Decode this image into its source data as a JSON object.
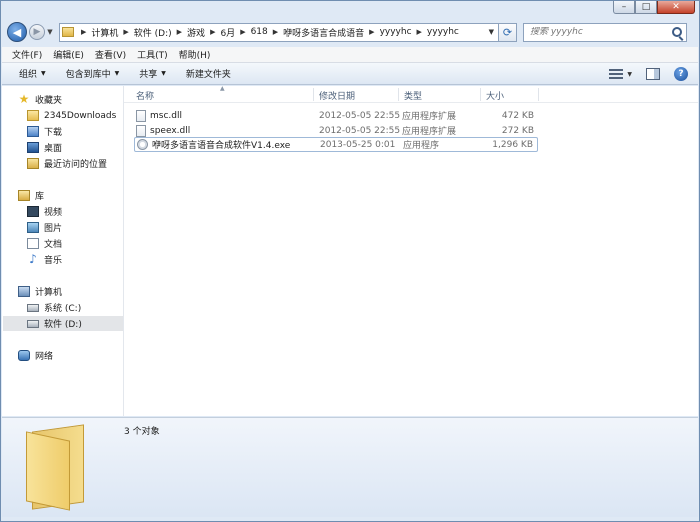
{
  "caption": {
    "minimize": "–",
    "maximize": "□",
    "close": "✕"
  },
  "address": {
    "breadcrumbs": [
      "计算机",
      "软件 (D:)",
      "游戏",
      "6月",
      "618",
      "咿呀多语言合成语音",
      "yyyyhc",
      "yyyyhc"
    ]
  },
  "search": {
    "placeholder": "搜索 yyyyhc"
  },
  "menu": [
    "文件(F)",
    "编辑(E)",
    "查看(V)",
    "工具(T)",
    "帮助(H)"
  ],
  "toolbar": {
    "organize": "组织",
    "include_in_library": "包含到库中",
    "share": "共享",
    "new_folder": "新建文件夹"
  },
  "nav": {
    "favorites": "收藏夹",
    "downloads_2345": "2345Downloads",
    "downloads": "下载",
    "desktop": "桌面",
    "recent": "最近访问的位置",
    "libraries": "库",
    "videos": "视频",
    "pictures": "图片",
    "documents": "文档",
    "music": "音乐",
    "computer": "计算机",
    "drive_c": "系统 (C:)",
    "drive_d": "软件 (D:)",
    "network": "网络"
  },
  "columns": {
    "name": "名称",
    "date": "修改日期",
    "type": "类型",
    "size": "大小"
  },
  "files": [
    {
      "name": "msc.dll",
      "date": "2012-05-05 22:55",
      "type": "应用程序扩展",
      "size": "472 KB"
    },
    {
      "name": "speex.dll",
      "date": "2012-05-05 22:55",
      "type": "应用程序扩展",
      "size": "272 KB"
    },
    {
      "name": "咿呀多语言语音合成软件V1.4.exe",
      "date": "2013-05-25 0:01",
      "type": "应用程序",
      "size": "1,296 KB"
    }
  ],
  "details": {
    "item_count": "3 个对象"
  }
}
